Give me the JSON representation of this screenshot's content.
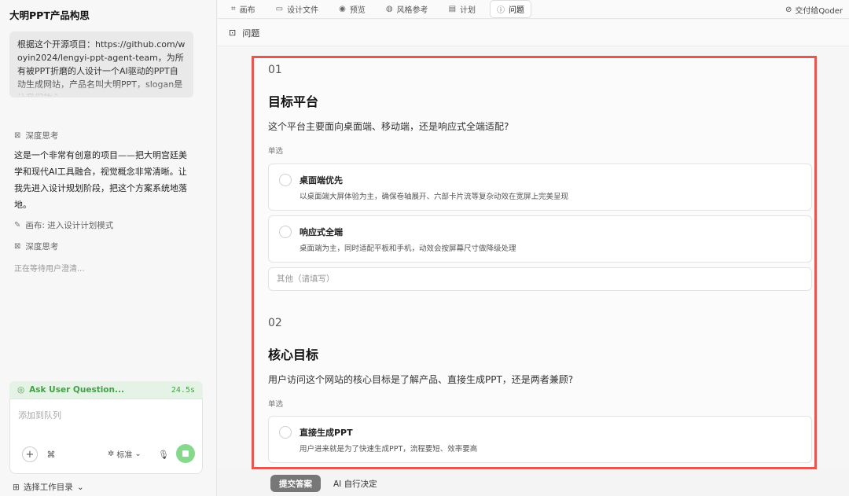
{
  "sidebar": {
    "app_title": "大明PPT产品构思",
    "prompt": "根据这个开源项目：https://github.com/woyin2024/lengyi-ppt-agent-team，为所有被PPT折磨的人设计一个AI驱动的PPT自动生成网站，产品名叫大明PPT，slogan是让我们放心",
    "deep_think_label": "深度思考",
    "think_text": "这是一个非常有创意的项目——把大明宫廷美学和现代AI工具融合，视觉概念非常清晰。让我先进入设计规划阶段，把这个方案系统地落地。",
    "tool_call": "画布: 进入设计计划模式",
    "deep_think_label_2": "深度思考",
    "waiting": "正在等待用户澄清...",
    "ask_label": "Ask User Question...",
    "ask_time": "24.5s",
    "composer_placeholder": "添加到队列",
    "mode_label": "标准",
    "workspace_label": "选择工作目录"
  },
  "topbar": {
    "tabs": [
      {
        "label": "画布",
        "icon": "canvas-grid-icon"
      },
      {
        "label": "设计文件",
        "icon": "file-icon"
      },
      {
        "label": "预览",
        "icon": "eye-icon"
      },
      {
        "label": "风格参考",
        "icon": "palette-icon"
      },
      {
        "label": "计划",
        "icon": "clipboard-icon"
      },
      {
        "label": "问题",
        "icon": "question-icon"
      }
    ],
    "handover": "交付给Qoder"
  },
  "panel": {
    "title": "问题"
  },
  "questions": [
    {
      "num": "01",
      "title": "目标平台",
      "desc": "这个平台主要面向桌面端、移动端，还是响应式全端适配?",
      "type": "单选",
      "options": [
        {
          "label": "桌面端优先",
          "desc": "以桌面端大屏体验为主，确保卷轴展开、六部卡片流等复杂动效在宽屏上完美呈现"
        },
        {
          "label": "响应式全端",
          "desc": "桌面端为主，同时适配平板和手机，动效会按屏幕尺寸做降级处理"
        }
      ],
      "other_placeholder": "其他（请填写）"
    },
    {
      "num": "02",
      "title": "核心目标",
      "desc": "用户访问这个网站的核心目标是了解产品、直接生成PPT，还是两者兼顾?",
      "type": "单选",
      "options": [
        {
          "label": "直接生成PPT",
          "desc": "用户进来就是为了快速生成PPT，流程要短、效率要高"
        }
      ]
    }
  ],
  "bottom": {
    "submit_label": "提交答案",
    "ai_decide_label": "AI 自行决定"
  },
  "colors": {
    "highlight_border": "#e8574f",
    "accent_green": "#43a047",
    "stop_button": "#86d98c"
  }
}
